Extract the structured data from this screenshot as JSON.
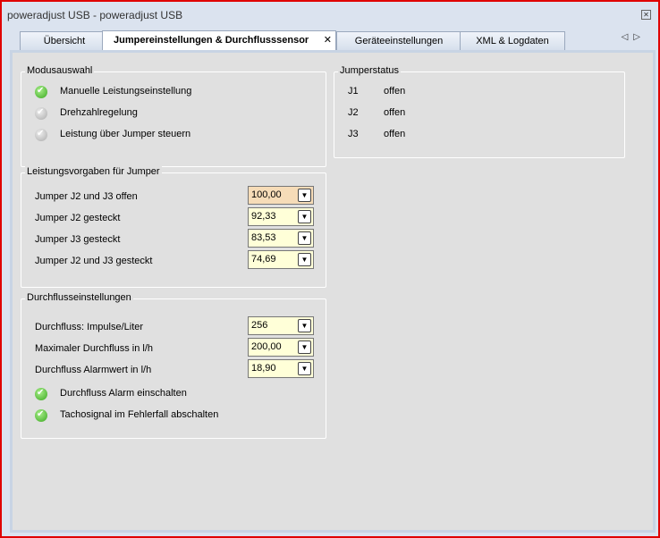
{
  "window": {
    "title": "poweradjust USB - poweradjust USB"
  },
  "tabs": [
    "Übersicht",
    "Jumpereinstellungen & Durchflusssensor",
    "Geräteeinstellungen",
    "XML & Logdaten"
  ],
  "modus": {
    "title": "Modusauswahl",
    "items": [
      {
        "label": "Manuelle Leistungseinstellung",
        "checked": true
      },
      {
        "label": "Drehzahlregelung",
        "checked": false
      },
      {
        "label": "Leistung über Jumper steuern",
        "checked": false
      }
    ]
  },
  "jumperstatus": {
    "title": "Jumperstatus",
    "items": [
      {
        "name": "J1",
        "state": "offen"
      },
      {
        "name": "J2",
        "state": "offen"
      },
      {
        "name": "J3",
        "state": "offen"
      }
    ]
  },
  "leistung": {
    "title": "Leistungsvorgaben für Jumper",
    "items": [
      {
        "label": "Jumper J2 und J3 offen",
        "value": "100,00"
      },
      {
        "label": "Jumper J2 gesteckt",
        "value": "92,33"
      },
      {
        "label": "Jumper J3 gesteckt",
        "value": "83,53"
      },
      {
        "label": "Jumper J2 und J3 gesteckt",
        "value": "74,69"
      }
    ]
  },
  "durchfluss": {
    "title": "Durchflusseinstellungen",
    "items": [
      {
        "label": "Durchfluss: Impulse/Liter",
        "value": "256"
      },
      {
        "label": "Maximaler Durchfluss in l/h",
        "value": "200,00"
      },
      {
        "label": "Durchfluss Alarmwert in l/h",
        "value": "18,90"
      }
    ],
    "checks": [
      {
        "label": "Durchfluss Alarm einschalten",
        "checked": true
      },
      {
        "label": "Tachosignal im Fehlerfall abschalten",
        "checked": true
      }
    ]
  }
}
